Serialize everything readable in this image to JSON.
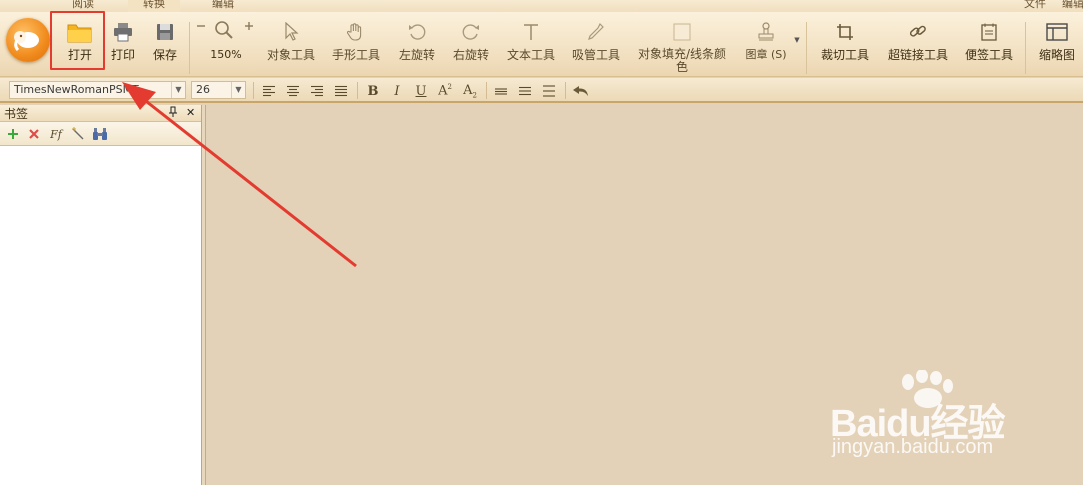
{
  "tabs": [
    {
      "label": "阅读",
      "active": false
    },
    {
      "label": "转换",
      "active": true
    },
    {
      "label": "编辑",
      "active": false
    }
  ],
  "top_right_menu": {
    "file": "文件",
    "edit": "编辑"
  },
  "ribbon": {
    "open": "打开",
    "print": "打印",
    "save": "保存",
    "zoom_level": "150%",
    "select_tool": "对象工具",
    "hand_tool": "手形工具",
    "rotate_left": "左旋转",
    "rotate_right": "右旋转",
    "text_tool": "文本工具",
    "eyedropper": "吸管工具",
    "fill_stroke": "对象填充/线条颜色",
    "stamp": "图章 (S)",
    "crop": "裁切工具",
    "hyperlink": "超链接工具",
    "sticky_note": "便签工具",
    "thumbnails": "缩略图"
  },
  "format_bar": {
    "font_name": "TimesNewRomanPSMT",
    "font_size": "26"
  },
  "bookmark_panel": {
    "title": "书签",
    "pin_glyph": "📌",
    "close_glyph": "✕"
  },
  "watermark": {
    "brand": "Baidu经验",
    "url": "jingyan.baidu.com"
  },
  "colors": {
    "accent_red": "#e33b2f",
    "canvas": "#e3d2b8",
    "ribbon": "#f4e4c6",
    "logo_orange": "#f08a1c"
  }
}
